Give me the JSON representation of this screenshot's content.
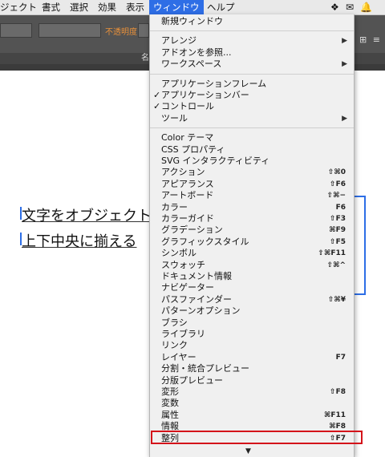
{
  "menubar": {
    "items": [
      "ジェクト",
      "書式",
      "選択",
      "効果",
      "表示",
      "ウィンドウ",
      "ヘルプ"
    ],
    "active_index": 5,
    "tray": [
      "dropbox-icon",
      "mail-icon",
      "bell-icon"
    ]
  },
  "toolbar": {
    "opacity_label": "不透明度：",
    "panel_title": "名",
    "right_icons": "⊟ ⊞ ≡"
  },
  "document": {
    "line1": "文字をオブジェクトの",
    "line2": "上下中央に揃える"
  },
  "menu": {
    "items": [
      {
        "label": "新規ウィンドウ"
      },
      {
        "label": "アレンジ",
        "submenu": true
      },
      {
        "label": "アドオンを参照..."
      },
      {
        "label": "ワークスペース",
        "submenu": true
      },
      {
        "label": "アプリケーションフレーム"
      },
      {
        "label": "アプリケーションバー",
        "checked": true
      },
      {
        "label": "コントロール",
        "checked": true
      },
      {
        "label": "ツール",
        "submenu": true
      },
      {
        "label": "Color テーマ"
      },
      {
        "label": "CSS プロパティ"
      },
      {
        "label": "SVG インタラクティビティ"
      },
      {
        "label": "アクション",
        "shortcut": "⇧⌘0"
      },
      {
        "label": "アピアランス",
        "shortcut": "⇧F6"
      },
      {
        "label": "アートボード",
        "shortcut": "⇧⌘−"
      },
      {
        "label": "カラー",
        "shortcut": "F6"
      },
      {
        "label": "カラーガイド",
        "shortcut": "⇧F3"
      },
      {
        "label": "グラデーション",
        "shortcut": "⌘F9"
      },
      {
        "label": "グラフィックスタイル",
        "shortcut": "⇧F5"
      },
      {
        "label": "シンボル",
        "shortcut": "⇧⌘F11"
      },
      {
        "label": "スウォッチ",
        "shortcut": "⇧⌘^"
      },
      {
        "label": "ドキュメント情報"
      },
      {
        "label": "ナビゲーター"
      },
      {
        "label": "パスファインダー",
        "shortcut": "⇧⌘¥"
      },
      {
        "label": "パターンオプション"
      },
      {
        "label": "ブラシ"
      },
      {
        "label": "ライブラリ"
      },
      {
        "label": "リンク"
      },
      {
        "label": "レイヤー",
        "shortcut": "F7"
      },
      {
        "label": "分割・統合プレビュー"
      },
      {
        "label": "分版プレビュー"
      },
      {
        "label": "変形",
        "shortcut": "⇧F8"
      },
      {
        "label": "変数"
      },
      {
        "label": "属性",
        "shortcut": "⌘F11"
      },
      {
        "label": "情報",
        "shortcut": "⌘F8"
      },
      {
        "label": "整列",
        "shortcut": "⇧F7"
      }
    ],
    "highlight_color": "#d4131a"
  }
}
